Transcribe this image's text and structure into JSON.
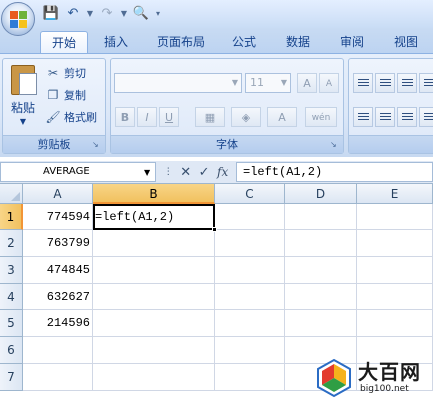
{
  "ribbon": {
    "tabs": [
      "开始",
      "插入",
      "页面布局",
      "公式",
      "数据",
      "审阅",
      "视图"
    ],
    "active_tab": "开始",
    "clipboard": {
      "paste_label": "粘贴",
      "cut_label": "剪切",
      "copy_label": "复制",
      "format_painter_label": "格式刷",
      "group_label": "剪贴板"
    },
    "font": {
      "font_name": "",
      "font_size": "11",
      "group_label": "字体",
      "grow_label": "A",
      "shrink_label": "A",
      "bold_label": "B",
      "italic_label": "I",
      "underline_label": "U",
      "font_color_label": "A",
      "phonetic_label": "wén"
    }
  },
  "formula_bar": {
    "name_box": "AVERAGE",
    "formula": "=left(A1,2)"
  },
  "grid": {
    "columns": [
      "A",
      "B",
      "C",
      "D",
      "E"
    ],
    "rows": [
      "1",
      "2",
      "3",
      "4",
      "5",
      "6",
      "7"
    ],
    "active_cell": "B1",
    "cells": {
      "A1": "774594",
      "A2": "763799",
      "A3": "474845",
      "A4": "632627",
      "A5": "214596",
      "B1": "=left(A1,2)"
    }
  },
  "watermark": {
    "title": "大百网",
    "url": "big100.net"
  },
  "colors": {
    "ribbon_bg": "#dbe7f8",
    "tab_text": "#15428b",
    "header_active": "#f1c15f",
    "grid_line": "#d0d7e5"
  }
}
